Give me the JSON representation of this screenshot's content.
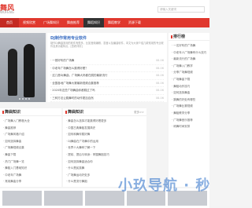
{
  "header": {
    "logo_text": "舞风",
    "logo_sub": "WUFENG",
    "search_placeholder": "请输入关键词"
  },
  "nav": [
    "首页",
    "视频欣赏",
    "广场舞知识",
    "舞曲推荐",
    "舞蹈知识",
    "舞蹈教学",
    "资源下载"
  ],
  "feature": {
    "title": "DJ制作常用专业软件",
    "desc": "制作DJ舞曲常用的软件有很多，比如音频编辑、混音以及编曲软件，本文为大家介绍几款常用的专业软件及其功能特点，[查看详情]",
    "items": [
      {
        "text": "一首好听的广场舞",
        "date": "08-06"
      },
      {
        "text": "中老年广场舞怎么跳得好看？",
        "date": "08-06"
      },
      {
        "text": "这几首DJ舞曲，广场舞大妈都在跳的最新流行",
        "date": "08-06"
      },
      {
        "text": "全国各地广场舞大赛最新视频合集推荐",
        "date": "08-06"
      },
      {
        "text": "2020年这些广场舞曲你都跳过了吗",
        "date": "08-06"
      },
      {
        "text": "三种方法让跳舞时的动作更加自然",
        "date": "08-06"
      }
    ]
  },
  "right_panel": {
    "title": "排行榜",
    "items": [
      "一名好听的广场舞",
      "中老年人广场舞有什么技巧",
      "最新流行的广场舞",
      "广场舞入门教学",
      "分享广场舞视频",
      "广场舞曲下载",
      "舞蹈动作技巧",
      "如何选择舞曲",
      "跳舞的好处有哪些",
      "广场舞比赛视频",
      "舞蹈教学分享",
      "广场舞音乐推荐",
      "练舞时间安排"
    ]
  },
  "col_left": {
    "title": "舞曲知识",
    "items": [
      "广场舞入门教程大全",
      "舞曲推荐",
      "广场舞风格介绍",
      "如何选择舞曲",
      "广场舞视频合集",
      "舞曲下载",
      "热门广场舞一览",
      "舞蹈入门基础知识",
      "中老年广场舞",
      "常用舞曲分享",
      "广场舞动作大全",
      "最新舞曲推荐",
      "舞蹈教学"
    ]
  },
  "col_mid": {
    "title": "舞曲知识",
    "more": "更多>>",
    "items": [
      "舞曲怎么选择才能跳得好看更多",
      "中国古典舞蹈发展简史",
      "如何和舞伴跳好舞",
      "DJ舞曲在广场舞中的运用",
      "世界十大舞种了解一下",
      "提前、提后与转身：掌握舞蹈技巧",
      "如何选择舞曲适合你",
      "什么是民族舞",
      "广场舞运动好处多",
      "什么是流行舞蹈",
      "什么是拉丁舞",
      "舞蹈教学"
    ]
  },
  "col_right": {
    "title": "舞曲知识",
    "items": [
      "一名好玩的舞蹈游戏",
      "什么叫中年人的舞蹈",
      "跳舞对身体的好处",
      "民族舞蹈的特点",
      "舞台表演技巧分享",
      "什么是交谊舞",
      "舞蹈基本功训练",
      "广场舞的起源",
      "学习舞蹈的方法",
      "了解爵士舞",
      "什么是街舞",
      "舞蹈比赛注意事项"
    ]
  },
  "watermark": "小玖导航 · 秒收"
}
